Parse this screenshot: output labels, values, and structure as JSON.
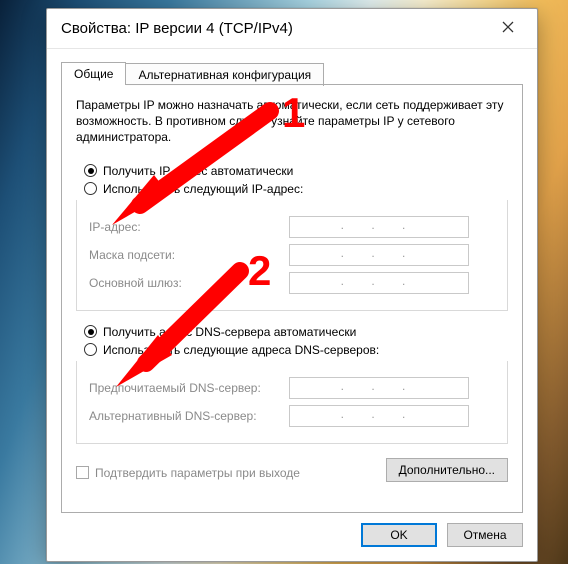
{
  "dialog": {
    "title": "Свойства: IP версии 4 (TCP/IPv4)"
  },
  "tabs": {
    "general": "Общие",
    "alternate": "Альтернативная конфигурация"
  },
  "intro_text": "Параметры IP можно назначать автоматически, если сеть поддерживает эту возможность. В противном случае узнайте параметры IP у сетевого администратора.",
  "ip_section": {
    "auto_label": "Получить IP-адрес автоматически",
    "manual_label": "Использовать следующий IP-адрес:",
    "fields": {
      "ip": "IP-адрес:",
      "mask": "Маска подсети:",
      "gateway": "Основной шлюз:"
    }
  },
  "dns_section": {
    "auto_label": "Получить адрес DNS-сервера автоматически",
    "manual_label": "Использовать следующие адреса DNS-серверов:",
    "fields": {
      "preferred": "Предпочитаемый DNS-сервер:",
      "alternate": "Альтернативный DNS-сервер:"
    }
  },
  "confirm_checkbox": "Подтвердить параметры при выходе",
  "advanced_button": "Дополнительно...",
  "buttons": {
    "ok": "OK",
    "cancel": "Отмена"
  },
  "ip_placeholder": ".   .   .",
  "annotations": {
    "one": "1",
    "two": "2"
  }
}
